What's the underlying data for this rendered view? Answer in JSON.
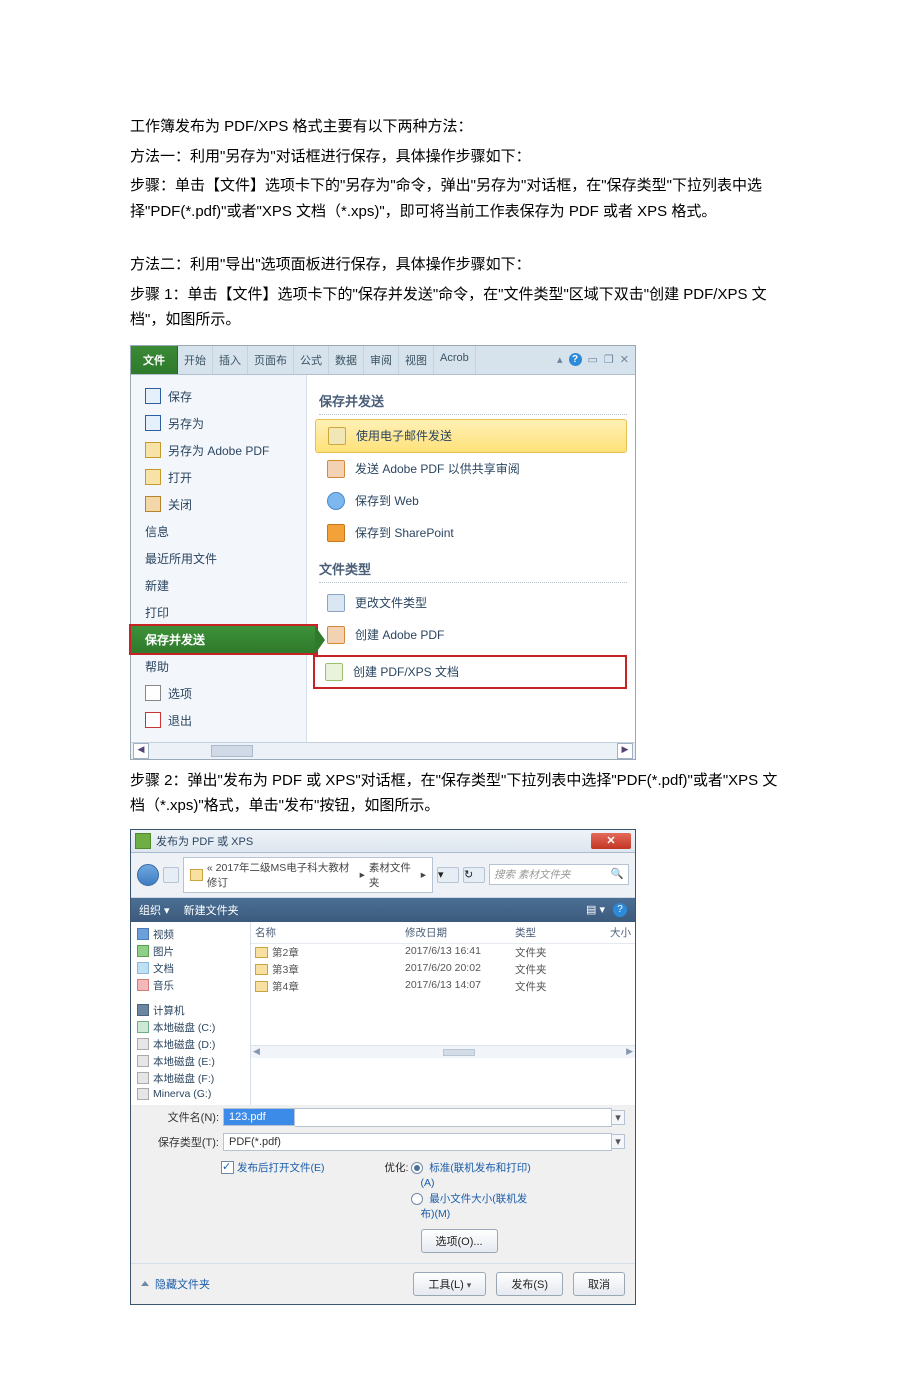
{
  "intro": {
    "p1": "工作簿发布为 PDF/XPS 格式主要有以下两种方法：",
    "p2": "方法一：利用\"另存为\"对话框进行保存，具体操作步骤如下：",
    "p3": "步骤：单击【文件】选项卡下的\"另存为\"命令，弹出\"另存为\"对话框，在\"保存类型\"下拉列表中选择\"PDF(*.pdf)\"或者\"XPS 文档（*.xps)\"，即可将当前工作表保存为 PDF 或者 XPS 格式。",
    "p4": "方法二：利用\"导出\"选项面板进行保存，具体操作步骤如下：",
    "p5": "步骤 1：单击【文件】选项卡下的\"保存并发送\"命令，在\"文件类型\"区域下双击\"创建 PDF/XPS 文档\"，如图所示。"
  },
  "shot1": {
    "ribbon": {
      "file": "文件",
      "tabs": [
        "开始",
        "插入",
        "页面布",
        "公式",
        "数据",
        "审阅",
        "视图",
        "Acrob"
      ],
      "win": {
        "min": "▴",
        "help": "?",
        "minimize": "▭",
        "restore": "❐",
        "close": "✕"
      }
    },
    "left": {
      "save": "保存",
      "saveAs": "另存为",
      "saveAsPdf": "另存为 Adobe PDF",
      "open": "打开",
      "close": "关闭",
      "info": "信息",
      "recent": "最近所用文件",
      "new": "新建",
      "print": "打印",
      "saveSend": "保存并发送",
      "help": "帮助",
      "options": "选项",
      "exit": "退出"
    },
    "right": {
      "h1": "保存并发送",
      "o1": "使用电子邮件发送",
      "o2": "发送 Adobe PDF 以供共享审阅",
      "o3": "保存到 Web",
      "o4": "保存到 SharePoint",
      "h2": "文件类型",
      "o5": "更改文件类型",
      "o6": "创建 Adobe PDF",
      "o7": "创建 PDF/XPS 文档"
    }
  },
  "mid": {
    "p1": "步骤 2：弹出\"发布为 PDF 或 XPS\"对话框，在\"保存类型\"下拉列表中选择\"PDF(*.pdf)\"或者\"XPS 文档（*.xps)\"格式，单击\"发布\"按钮，如图所示。"
  },
  "shot2": {
    "title": "发布为 PDF 或 XPS",
    "crumb": {
      "a": "«  2017年二级MS电子科大教材修订",
      "b": "素材文件夹"
    },
    "searchPlaceholder": "搜索 素材文件夹",
    "toolbar": {
      "org": "组织 ▾",
      "newFolder": "新建文件夹",
      "view": "▤ ▾"
    },
    "tree": {
      "video": "视频",
      "pic": "图片",
      "doc": "文档",
      "music": "音乐",
      "pc": "计算机",
      "c": "本地磁盘 (C:)",
      "d": "本地磁盘 (D:)",
      "e": "本地磁盘 (E:)",
      "f": "本地磁盘 (F:)",
      "g": "Minerva (G:)"
    },
    "cols": {
      "name": "名称",
      "date": "修改日期",
      "type": "类型",
      "size": "大小"
    },
    "rows": [
      {
        "n": "第2章",
        "d": "2017/6/13 16:41",
        "t": "文件夹"
      },
      {
        "n": "第3章",
        "d": "2017/6/20 20:02",
        "t": "文件夹"
      },
      {
        "n": "第4章",
        "d": "2017/6/13 14:07",
        "t": "文件夹"
      }
    ],
    "fileNameLabel": "文件名(N):",
    "fileName": "123.pdf",
    "saveTypeLabel": "保存类型(T):",
    "saveType": "PDF(*.pdf)",
    "openAfter": "发布后打开文件(E)",
    "optimize": {
      "label": "优化:",
      "o1a": "标准(联机发布和打印)",
      "o1b": "(A)",
      "o2a": "最小文件大小(联机发",
      "o2b": "布)(M)"
    },
    "optionsBtn": "选项(O)...",
    "hide": "隐藏文件夹",
    "tools": "工具(L)",
    "publish": "发布(S)",
    "cancel": "取消"
  }
}
